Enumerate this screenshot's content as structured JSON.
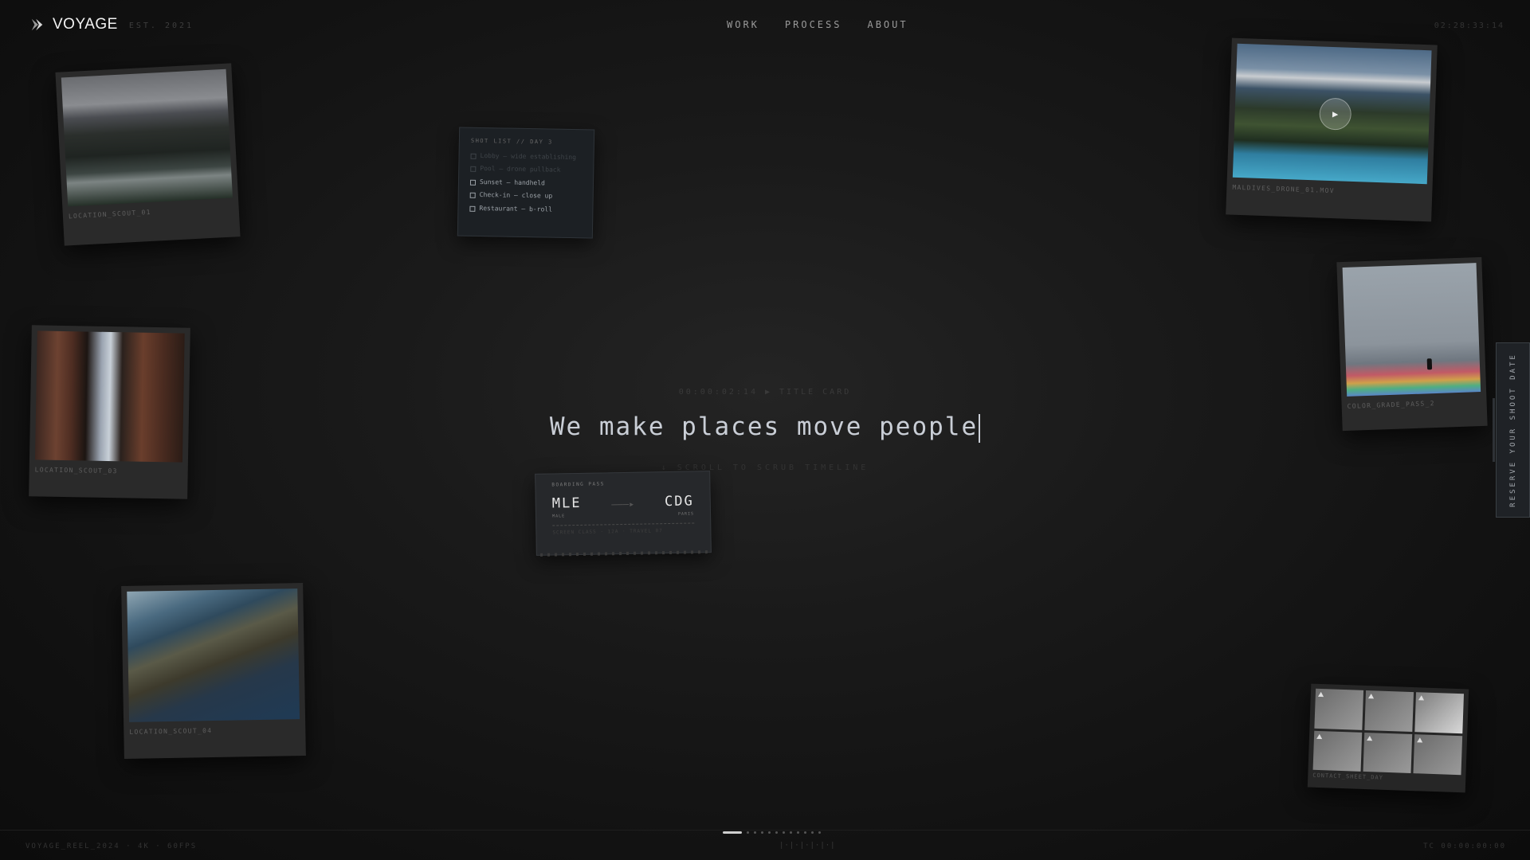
{
  "brand": {
    "name": "VOYAGE",
    "est": "EST. 2021"
  },
  "nav": {
    "items": [
      "WORK",
      "PROCESS",
      "ABOUT"
    ]
  },
  "clock": "02:28:33:14",
  "photos": {
    "p1": "LOCATION_SCOUT_01",
    "p2": "LOCATION_SCOUT_03",
    "p3": "LOCATION_SCOUT_04",
    "p4": "MALDIVES_DRONE_01.MOV",
    "p5": "COLOR_GRADE_PASS_2",
    "contact": "CONTACT_SHEET_DAY"
  },
  "shot_list": {
    "title": "SHOT LIST // DAY 3",
    "items": [
      {
        "label": "Lobby — wide establishing",
        "done": true
      },
      {
        "label": "Pool — drone pullback",
        "done": true
      },
      {
        "label": "Sunset — handheld",
        "done": false
      },
      {
        "label": "Check-in — close up",
        "done": false
      },
      {
        "label": "Restaurant — b-roll",
        "done": false
      }
    ]
  },
  "boarding_pass": {
    "title": "BOARDING PASS",
    "from_code": "MLE",
    "from_city": "MALE",
    "to_code": "CDG",
    "to_city": "PARIS",
    "footer": "SCREEN CLASS · 12A · TRAVEL 07"
  },
  "hero": {
    "timecode": "00:00:02:14 ▶ TITLE CARD",
    "headline": "We make places move people",
    "scroll_hint": "↓ SCROLL TO SCRUB TIMELINE"
  },
  "cta": {
    "reserve": "RESERVE YOUR SHOOT DATE"
  },
  "footer": {
    "reel": "VOYAGE_REEL_2024 · 4K · 60FPS",
    "tc": "TC 00:00:00:00",
    "dots": 12,
    "active_dot": 0,
    "ruler": "|·|·|·|·|·|"
  },
  "colors": {
    "accent": "#cfcfcf",
    "background": "#121212"
  }
}
